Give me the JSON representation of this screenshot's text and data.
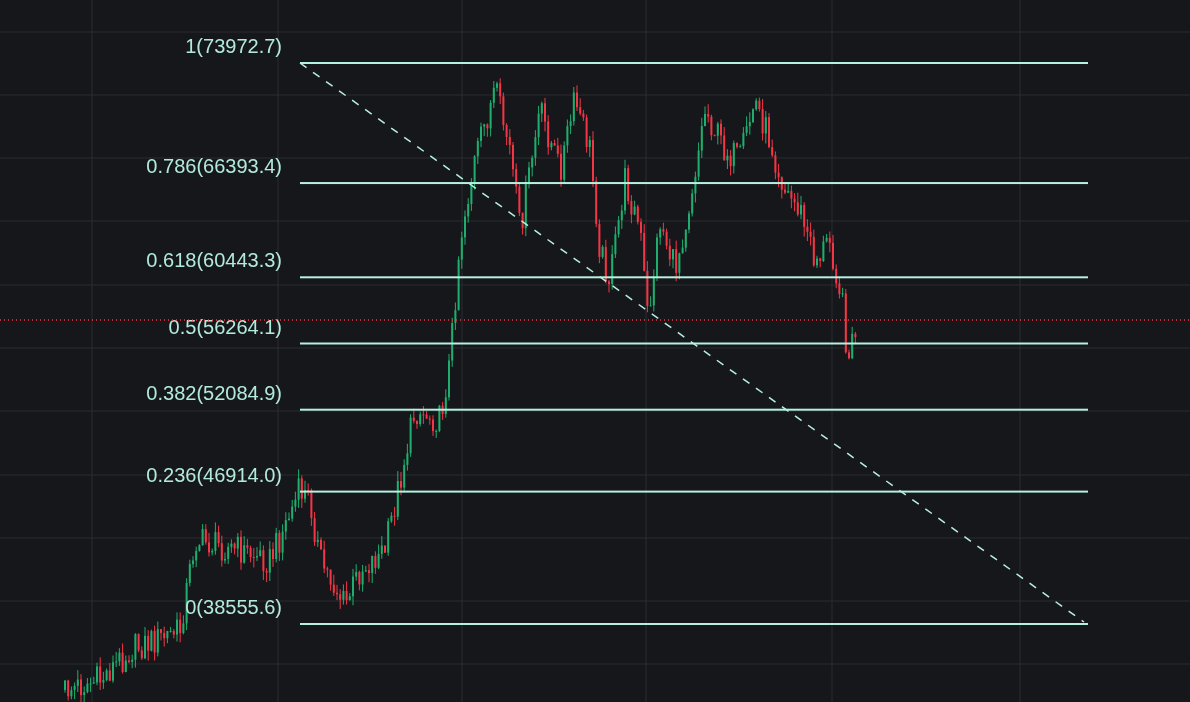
{
  "fib_levels": [
    {
      "label": "1(73972.7)"
    },
    {
      "label": "0.786(66393.4)"
    },
    {
      "label": "0.618(60443.3)"
    },
    {
      "label": "0.5(56264.1)"
    },
    {
      "label": "0.382(52084.9)"
    },
    {
      "label": "0.236(46914.0)"
    },
    {
      "label": "0(38555.6)"
    }
  ]
}
